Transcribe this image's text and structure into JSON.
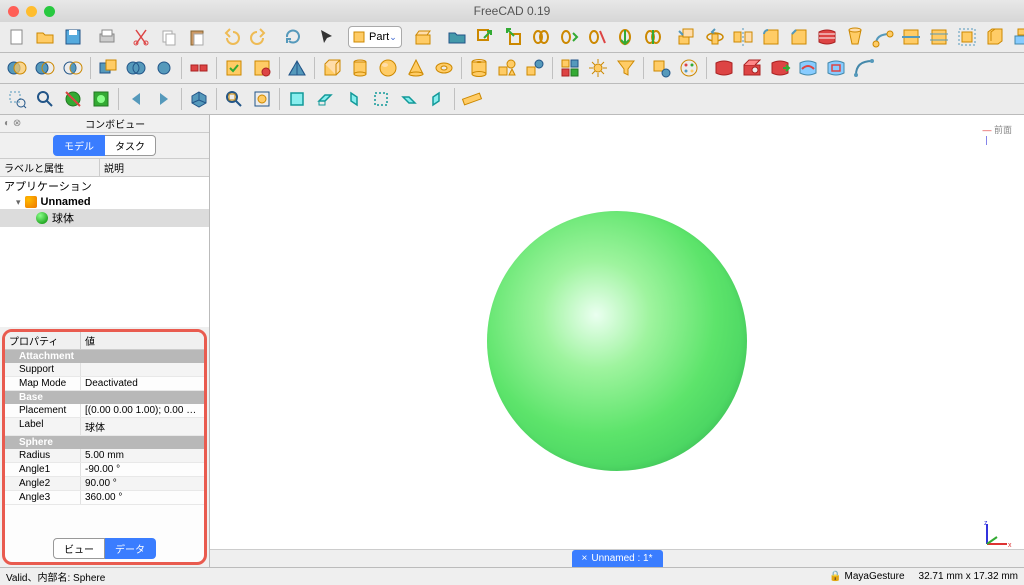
{
  "app_title": "FreeCAD 0.19",
  "workbench": "Part",
  "combo_view": {
    "title": "コンボビュー",
    "tabs": [
      "モデル",
      "タスク"
    ],
    "active_tab": 0,
    "tree_header": {
      "col1": "ラベルと属性",
      "col2": "説明"
    },
    "tree": {
      "root": "アプリケーション",
      "doc": "Unnamed",
      "item": "球体"
    }
  },
  "property_panel": {
    "header": {
      "col1": "プロパティ",
      "col2": "値"
    },
    "groups": [
      {
        "name": "Attachment",
        "rows": [
          {
            "key": "Support",
            "val": ""
          },
          {
            "key": "Map Mode",
            "val": "Deactivated"
          }
        ]
      },
      {
        "name": "Base",
        "rows": [
          {
            "key": "Placement",
            "val": "[(0.00 0.00 1.00); 0.00 °;..."
          },
          {
            "key": "Label",
            "val": "球体"
          }
        ]
      },
      {
        "name": "Sphere",
        "rows": [
          {
            "key": "Radius",
            "val": "5.00 mm"
          },
          {
            "key": "Angle1",
            "val": "-90.00 °"
          },
          {
            "key": "Angle2",
            "val": "90.00 °"
          },
          {
            "key": "Angle3",
            "val": "360.00 °"
          }
        ]
      }
    ],
    "bottom_tabs": [
      "ビュー",
      "データ"
    ],
    "active_bottom": 1
  },
  "doc_tab": "Unnamed : 1*",
  "status": {
    "left": "Valid、内部名: Sphere",
    "nav": "MayaGesture",
    "dims": "32.71 mm x 17.32 mm"
  },
  "axis_label": "前面",
  "colors": {
    "accent": "#3a7dff",
    "highlight_border": "#e95b4f",
    "sphere": "#5de46b"
  }
}
